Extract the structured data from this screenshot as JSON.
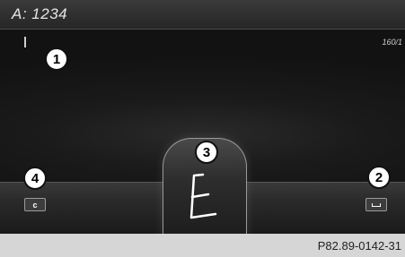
{
  "input": {
    "address_text": "A: 1234",
    "counter": "160/1"
  },
  "keys": {
    "delete_label": "c",
    "space_icon": "space-bar-icon"
  },
  "handwriting": {
    "recognized_letter": "E"
  },
  "callouts": [
    "1",
    "2",
    "3",
    "4"
  ],
  "footer": {
    "reference": "P82.89-0142-31"
  }
}
